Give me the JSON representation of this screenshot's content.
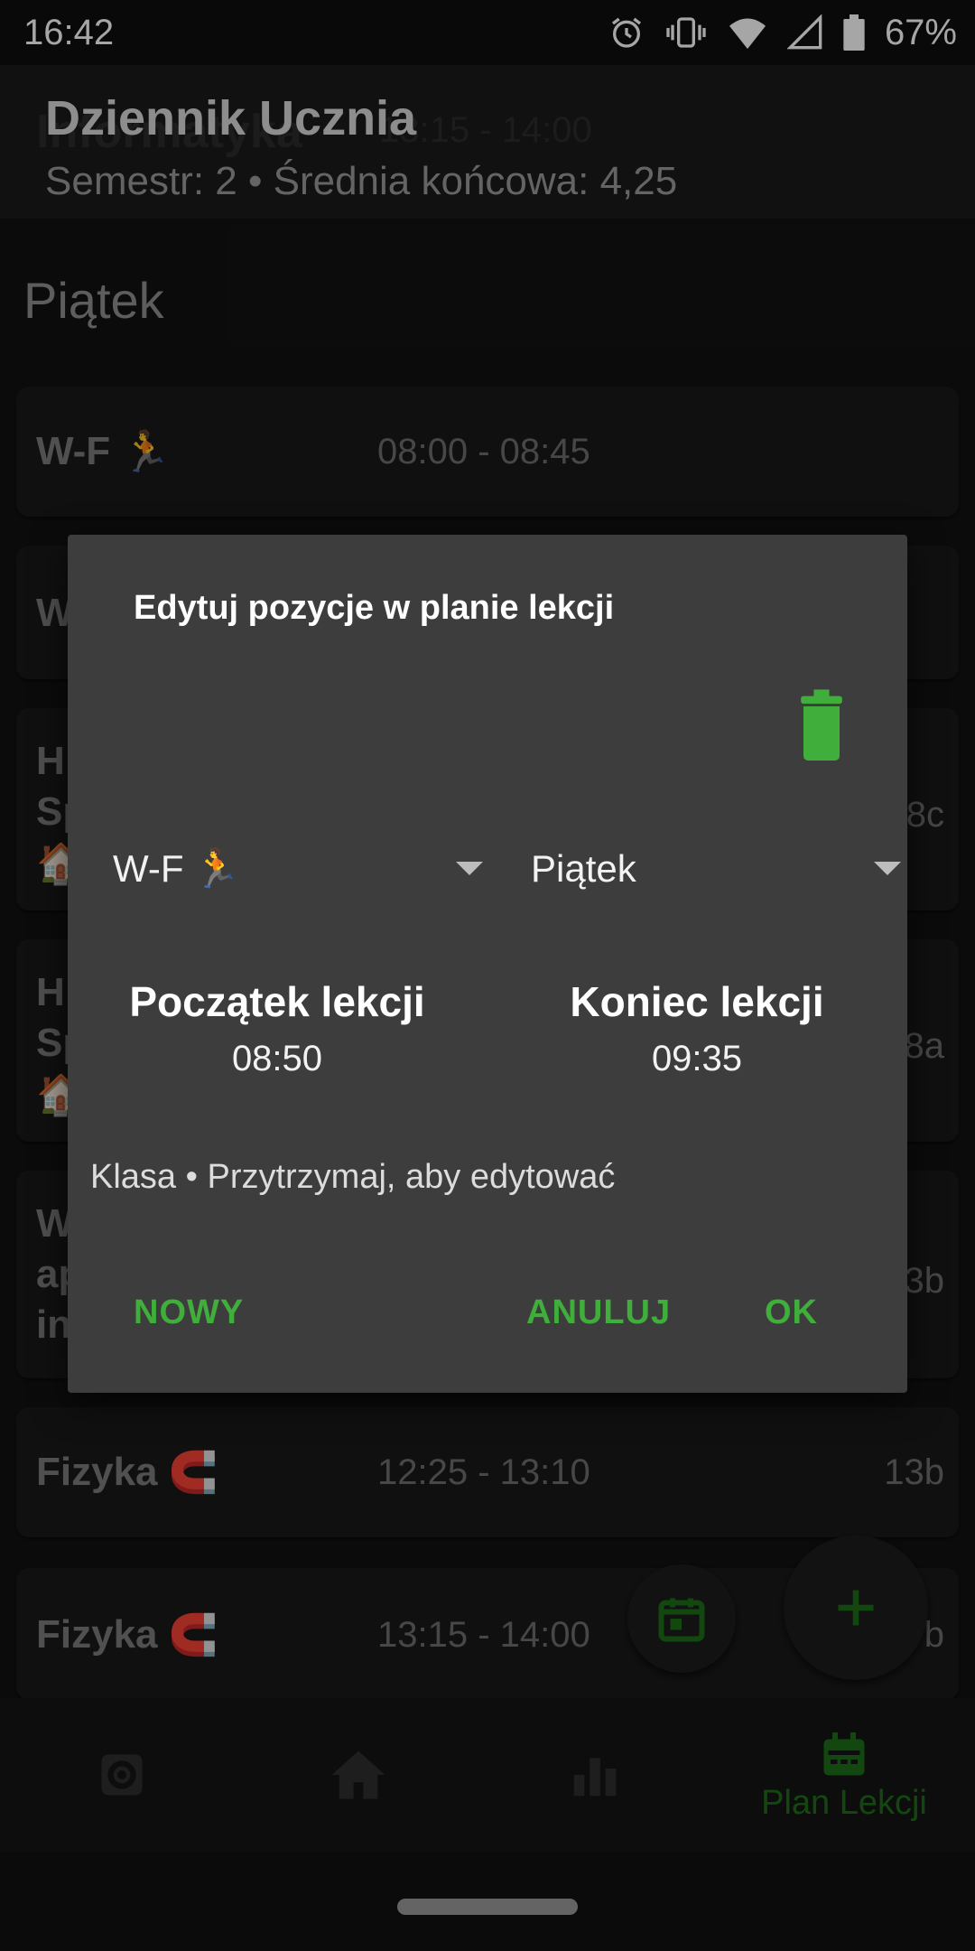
{
  "status_bar": {
    "time": "16:42",
    "battery_percent": "67%",
    "icons": [
      "alarm-icon",
      "vibrate-icon",
      "wifi-icon",
      "cell-signal-icon",
      "battery-icon"
    ]
  },
  "app_bar": {
    "title": "Dziennik Ucznia",
    "subtitle": "Semestr: 2 • Średnia końcowa: 4,25",
    "ghost_title": "Informatyka",
    "ghost_time": "13:15 - 14:00"
  },
  "day_header": "Piątek",
  "lessons": [
    {
      "subject": "W-F",
      "emoji": "🏃",
      "time": "08:00 - 08:45",
      "room": ""
    },
    {
      "subject": "W",
      "emoji": "",
      "time": "",
      "room": ""
    },
    {
      "subject": "H",
      "line2": "Sp",
      "emoji": "🏠",
      "time": "",
      "room": "8c"
    },
    {
      "subject": "H",
      "line2": "Sp",
      "emoji": "🏠",
      "time": "",
      "room": "8a"
    },
    {
      "subject": "W",
      "line2": "ap",
      "line3": "in",
      "emoji": "",
      "time": "",
      "room": "3b"
    },
    {
      "subject": "Fizyka",
      "emoji": "🧲",
      "time": "12:25 - 13:10",
      "room": "13b"
    },
    {
      "subject": "Fizyka",
      "emoji": "🧲",
      "time": "13:15 - 14:00",
      "room": "b"
    }
  ],
  "dialog": {
    "title": "Edytuj pozycje w planie lekcji",
    "subject_spinner": {
      "value": "W-F",
      "emoji": "🏃"
    },
    "day_spinner": {
      "value": "Piątek"
    },
    "start": {
      "label": "Początek lekcji",
      "value": "08:50"
    },
    "end": {
      "label": "Koniec lekcji",
      "value": "09:35"
    },
    "hint": "Klasa • Przytrzymaj, aby edytować",
    "buttons": {
      "new": "NOWY",
      "cancel": "ANULUJ",
      "ok": "OK"
    }
  },
  "bottom_nav": {
    "items": [
      {
        "icon": "settings-icon",
        "label": ""
      },
      {
        "icon": "home-icon",
        "label": ""
      },
      {
        "icon": "chart-icon",
        "label": ""
      },
      {
        "icon": "calendar-icon",
        "label": "Plan Lekcji"
      }
    ]
  },
  "colors": {
    "accent_green": "#3fae3b",
    "dialog_bg": "#3d3d3d",
    "background": "#121212"
  }
}
